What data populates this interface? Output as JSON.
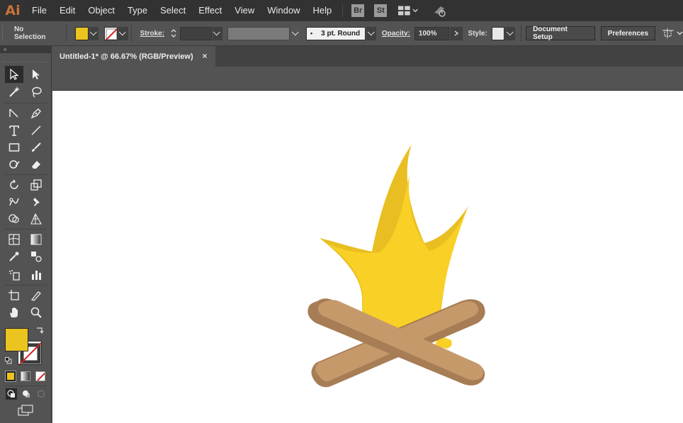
{
  "app": {
    "logo": "Ai"
  },
  "menubar": {
    "items": [
      "File",
      "Edit",
      "Object",
      "Type",
      "Select",
      "Effect",
      "View",
      "Window",
      "Help"
    ],
    "bridge_label": "Br",
    "stock_label": "St"
  },
  "controlbar": {
    "selection_label": "No Selection",
    "fill_color": "#ECC420",
    "stroke_label": "Stroke:",
    "brush_label": "3 pt. Round",
    "opacity_label": "Opacity:",
    "opacity_value": "100%",
    "style_label": "Style:",
    "document_setup_label": "Document Setup",
    "preferences_label": "Preferences"
  },
  "document": {
    "tab_title": "Untitled-1* @ 66.67% (RGB/Preview)",
    "close_glyph": "×"
  },
  "toolbar": {
    "collapse_glyph": "«",
    "fill_color": "#ECC420",
    "stroke_color": "none"
  },
  "artwork": {
    "flame_outer_color": "#E8BE22",
    "flame_inner_color": "#F9D025",
    "log_light_color": "#C6996B",
    "log_dark_color": "#A67D55"
  }
}
